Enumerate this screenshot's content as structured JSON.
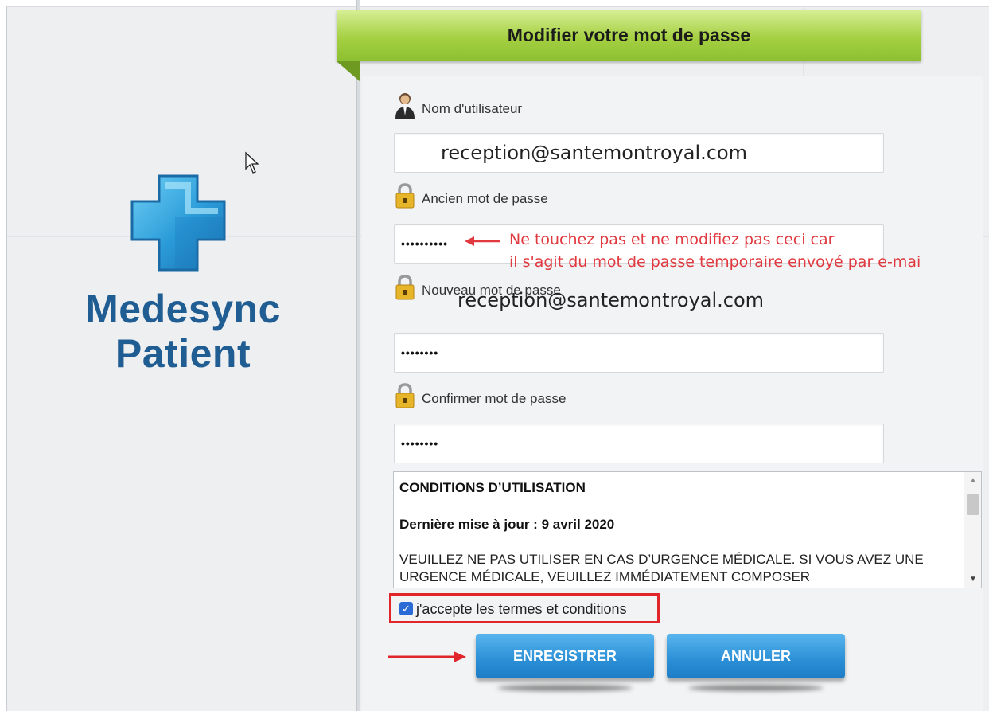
{
  "branding": {
    "line1": "Medesync",
    "line2": "Patient"
  },
  "header": {
    "title": "Modifier votre mot de passe"
  },
  "form": {
    "username_label": "Nom d'utilisateur",
    "username_value": "reception@santemontroyal.com",
    "old_password_label": "Ancien mot de passe",
    "old_password_mask": "••••••••••",
    "new_password_label": "Nouveau mot de passe",
    "new_password_mask": "••••••••",
    "confirm_password_label": "Confirmer mot de passe",
    "confirm_password_mask": "••••••••"
  },
  "annotation": {
    "line1": "Ne touchez pas et ne modifiez pas ceci car",
    "line2": "il s'agit du mot de passe temporaire envoyé par e-mai",
    "overlay_email": "reception@santemontroyal.com",
    "color": "#e0393f"
  },
  "terms": {
    "title": "CONDITIONS D’UTILISATION",
    "updated": "Dernière mise à jour : 9 avril 2020",
    "body": "VEUILLEZ NE PAS UTILISER EN CAS D’URGENCE MÉDICALE. SI VOUS AVEZ UNE URGENCE MÉDICALE, VEUILLEZ IMMÉDIATEMENT COMPOSER"
  },
  "accept": {
    "label": "j'accepte les termes et conditions",
    "checked": true
  },
  "buttons": {
    "save": "ENREGISTRER",
    "cancel": "ANNULER"
  },
  "colors": {
    "brand_blue": "#1f5d93",
    "header_green": "#a5d042",
    "button_blue": "#2b8fd6",
    "highlight_red": "#e0252b"
  }
}
